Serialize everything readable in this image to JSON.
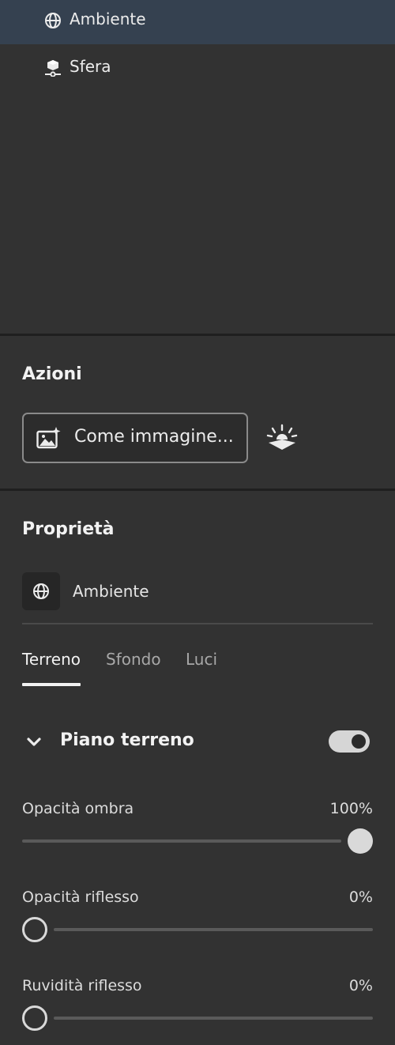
{
  "scene_tree": {
    "items": [
      {
        "label": "Ambiente",
        "icon": "globe-icon",
        "selected": true
      },
      {
        "label": "Sfera",
        "icon": "object-icon",
        "selected": false
      }
    ]
  },
  "actions": {
    "title": "Azioni",
    "render_button_label": "Come immagine...",
    "render_icon": "image-sparkle-icon",
    "lighting_icon": "sun-icon"
  },
  "properties": {
    "title": "Proprietà",
    "object_label": "Ambiente",
    "tabs": [
      {
        "label": "Terreno",
        "active": true
      },
      {
        "label": "Sfondo",
        "active": false
      },
      {
        "label": "Luci",
        "active": false
      }
    ],
    "group": {
      "title": "Piano terreno",
      "expanded": true,
      "enabled": true
    },
    "sliders": [
      {
        "label": "Opacità ombra",
        "value_text": "100%",
        "value": 1.0
      },
      {
        "label": "Opacità riflesso",
        "value_text": "0%",
        "value": 0.0
      },
      {
        "label": "Ruvidità riflesso",
        "value_text": "0%",
        "value": 0.0
      }
    ]
  },
  "colors": {
    "panel_bg": "#323232",
    "selected_bg": "#354150",
    "divider": "#1f1f1f",
    "text": "#e6e6e6"
  }
}
